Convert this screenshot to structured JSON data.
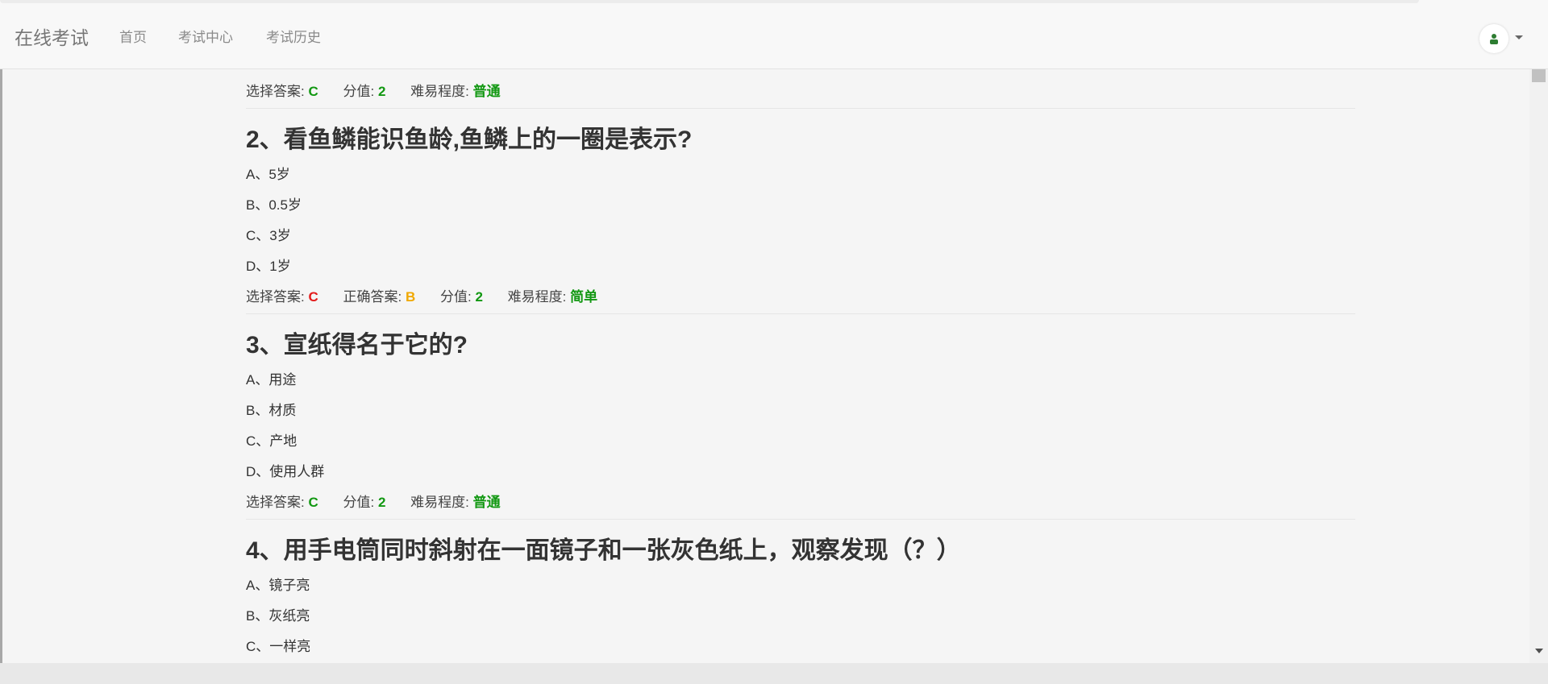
{
  "header": {
    "brand": "在线考试",
    "nav": [
      "首页",
      "考试中心",
      "考试历史"
    ]
  },
  "questions": [
    {
      "title": "",
      "options": [],
      "meta": {
        "selected_label": "选择答案:",
        "selected": "C",
        "correct_label": "",
        "correct": "",
        "score_label": "分值:",
        "score": "2",
        "difficulty_label": "难易程度:",
        "difficulty": "普通"
      }
    },
    {
      "title": "2、看鱼鳞能识鱼龄,鱼鳞上的一圈是表示?",
      "options": [
        "A、5岁",
        "B、0.5岁",
        "C、3岁",
        "D、1岁"
      ],
      "meta": {
        "selected_label": "选择答案:",
        "selected": "C",
        "correct_label": "正确答案:",
        "correct": "B",
        "score_label": "分值:",
        "score": "2",
        "difficulty_label": "难易程度:",
        "difficulty": "简单"
      }
    },
    {
      "title": "3、宣纸得名于它的?",
      "options": [
        "A、用途",
        "B、材质",
        "C、产地",
        "D、使用人群"
      ],
      "meta": {
        "selected_label": "选择答案:",
        "selected": "C",
        "correct_label": "",
        "correct": "",
        "score_label": "分值:",
        "score": "2",
        "difficulty_label": "难易程度:",
        "difficulty": "普通"
      }
    },
    {
      "title": "4、用手电筒同时斜射在一面镜子和一张灰色纸上，观察发现（？）",
      "options": [
        "A、镜子亮",
        "B、灰纸亮",
        "C、一样亮"
      ],
      "meta": null
    }
  ],
  "colors": {
    "wrong": "#e31b1b",
    "correct": "#f0a800",
    "value": "#129812"
  }
}
